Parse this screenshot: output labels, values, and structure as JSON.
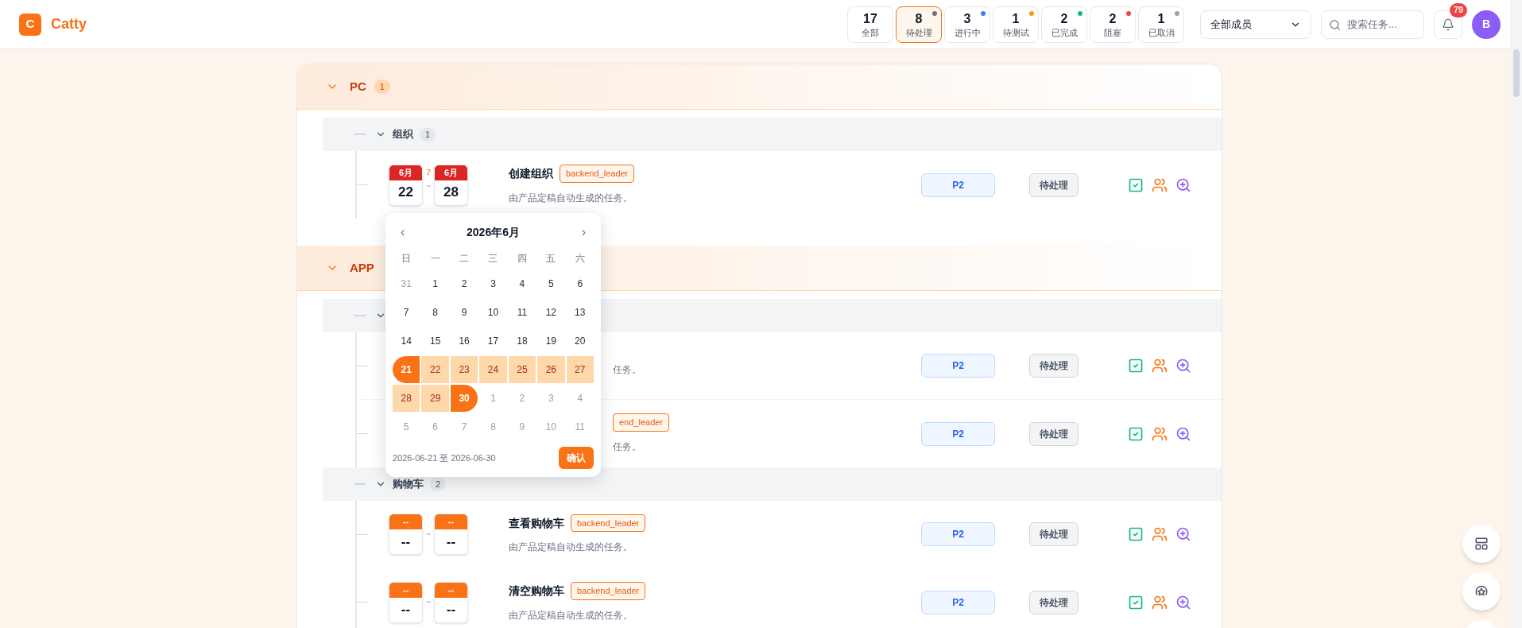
{
  "app": {
    "logo_letter": "C",
    "name": "Catty"
  },
  "status_filters": [
    {
      "count": "17",
      "label": "全部",
      "selected": false
    },
    {
      "count": "8",
      "label": "待处理",
      "selected": true,
      "color": "#6b7280"
    },
    {
      "count": "3",
      "label": "进行中",
      "selected": false,
      "color": "#3b82f6"
    },
    {
      "count": "1",
      "label": "待测试",
      "selected": false,
      "color": "#f59e0b"
    },
    {
      "count": "2",
      "label": "已完成",
      "selected": false,
      "color": "#10b981"
    },
    {
      "count": "2",
      "label": "阻塞",
      "selected": false,
      "color": "#ef4444"
    },
    {
      "count": "1",
      "label": "已取消",
      "selected": false,
      "color": "#9ca3af"
    }
  ],
  "member_select": {
    "value": "全部成员"
  },
  "search": {
    "placeholder": "搜索任务..."
  },
  "notifications": {
    "badge": "79"
  },
  "avatar": {
    "initial": "B"
  },
  "groups": [
    {
      "name": "PC",
      "count": "1",
      "expanded": true,
      "subgroups": [
        {
          "name": "组织",
          "count": "1",
          "expanded": true,
          "tasks": [
            {
              "kind": "full",
              "scheduled": true,
              "start": {
                "month": "6月",
                "day": "22"
              },
              "end": {
                "month": "6月",
                "day": "28"
              },
              "duration": "7",
              "separator": "~",
              "title": "创建组织",
              "tag": "backend_leader",
              "description": "由产品定稿自动生成的任务。",
              "priority": "P2",
              "status": "待处理"
            }
          ]
        }
      ]
    },
    {
      "name": "APP",
      "expanded": true,
      "subgroups": [
        {
          "expanded": true,
          "tasks": [
            {
              "kind": "partial",
              "description": "任务。",
              "priority": "P2",
              "status": "待处理"
            },
            {
              "kind": "partial",
              "tag": "end_leader",
              "description": "任务。",
              "priority": "P2",
              "status": "待处理"
            }
          ]
        },
        {
          "name": "购物车",
          "count": "2",
          "expanded": true,
          "tasks": [
            {
              "kind": "full",
              "scheduled": false,
              "start": {
                "month": "--",
                "day": "--"
              },
              "end": {
                "month": "--",
                "day": "--"
              },
              "separator": "~",
              "title": "查看购物车",
              "tag": "backend_leader",
              "description": "由产品定稿自动生成的任务。",
              "priority": "P2",
              "status": "待处理"
            },
            {
              "kind": "full",
              "scheduled": false,
              "start": {
                "month": "--",
                "day": "--"
              },
              "end": {
                "month": "--",
                "day": "--"
              },
              "separator": "~",
              "title": "清空购物车",
              "tag": "backend_leader",
              "description": "由产品定稿自动生成的任务。",
              "priority": "P2",
              "status": "待处理"
            }
          ]
        }
      ]
    }
  ],
  "date_picker": {
    "prev": "‹",
    "title": "2026年6月",
    "next": "›",
    "weekdays": [
      "日",
      "一",
      "二",
      "三",
      "四",
      "五",
      "六"
    ],
    "days": [
      {
        "label": "31",
        "kind": "outside"
      },
      {
        "label": "1",
        "kind": "normal"
      },
      {
        "label": "2",
        "kind": "normal"
      },
      {
        "label": "3",
        "kind": "normal"
      },
      {
        "label": "4",
        "kind": "normal"
      },
      {
        "label": "5",
        "kind": "normal"
      },
      {
        "label": "6",
        "kind": "normal"
      },
      {
        "label": "7",
        "kind": "normal"
      },
      {
        "label": "8",
        "kind": "normal"
      },
      {
        "label": "9",
        "kind": "normal"
      },
      {
        "label": "10",
        "kind": "normal"
      },
      {
        "label": "11",
        "kind": "normal"
      },
      {
        "label": "12",
        "kind": "normal"
      },
      {
        "label": "13",
        "kind": "normal"
      },
      {
        "label": "14",
        "kind": "normal"
      },
      {
        "label": "15",
        "kind": "normal"
      },
      {
        "label": "16",
        "kind": "normal"
      },
      {
        "label": "17",
        "kind": "normal"
      },
      {
        "label": "18",
        "kind": "normal"
      },
      {
        "label": "19",
        "kind": "normal"
      },
      {
        "label": "20",
        "kind": "normal"
      },
      {
        "label": "21",
        "kind": "start"
      },
      {
        "label": "22",
        "kind": "in_range"
      },
      {
        "label": "23",
        "kind": "in_range"
      },
      {
        "label": "24",
        "kind": "in_range"
      },
      {
        "label": "25",
        "kind": "in_range"
      },
      {
        "label": "26",
        "kind": "in_range"
      },
      {
        "label": "27",
        "kind": "in_range"
      },
      {
        "label": "28",
        "kind": "in_range"
      },
      {
        "label": "29",
        "kind": "in_range"
      },
      {
        "label": "30",
        "kind": "end"
      },
      {
        "label": "1",
        "kind": "outside"
      },
      {
        "label": "2",
        "kind": "outside"
      },
      {
        "label": "3",
        "kind": "outside"
      },
      {
        "label": "4",
        "kind": "outside"
      },
      {
        "label": "5",
        "kind": "outside"
      },
      {
        "label": "6",
        "kind": "outside"
      },
      {
        "label": "7",
        "kind": "outside"
      },
      {
        "label": "8",
        "kind": "outside"
      },
      {
        "label": "9",
        "kind": "outside"
      },
      {
        "label": "10",
        "kind": "outside"
      },
      {
        "label": "11",
        "kind": "outside"
      }
    ],
    "range_text": "2026-06-21 至 2026-06-30",
    "confirm": "确认"
  }
}
